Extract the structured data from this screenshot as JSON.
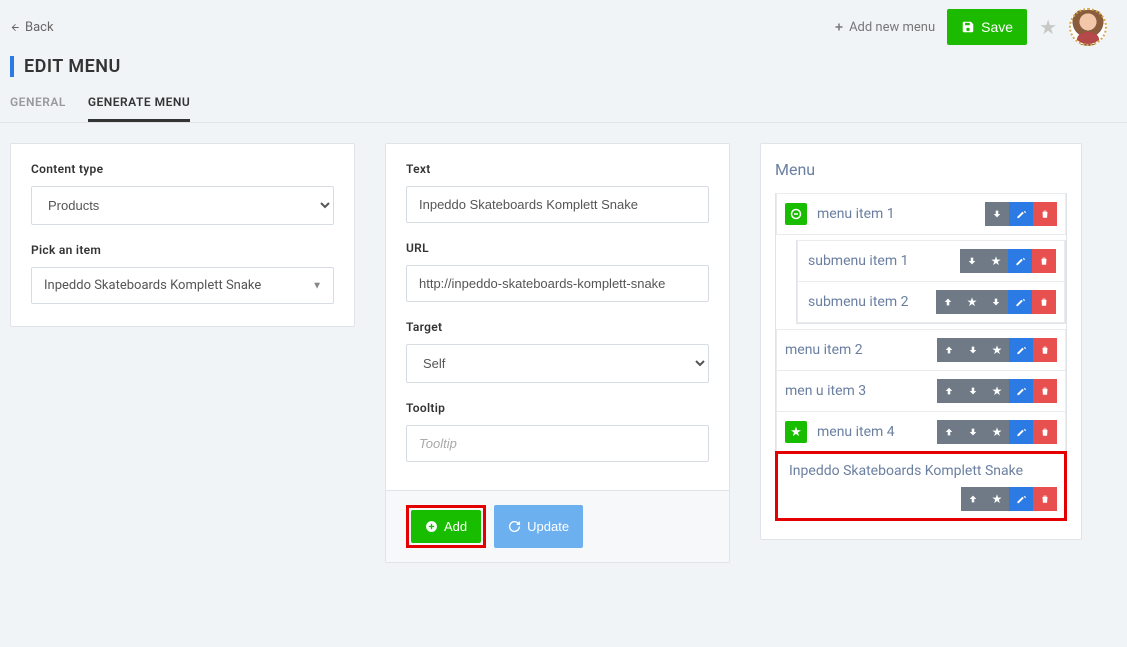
{
  "back_label": "Back",
  "header": {
    "add_menu_label": "Add new menu",
    "save_label": "Save"
  },
  "page_title": "EDIT MENU",
  "tabs": {
    "general": "GENERAL",
    "generate": "GENERATE MENU"
  },
  "left": {
    "content_type_label": "Content type",
    "content_type_value": "Products",
    "pick_item_label": "Pick an item",
    "pick_item_value": "Inpeddo Skateboards Komplett Snake"
  },
  "center": {
    "text_label": "Text",
    "text_value": "Inpeddo Skateboards Komplett Snake",
    "url_label": "URL",
    "url_value": "http://inpeddo-skateboards-komplett-snake",
    "target_label": "Target",
    "target_value": "Self",
    "tooltip_label": "Tooltip",
    "tooltip_placeholder": "Tooltip",
    "add_label": "Add",
    "update_label": "Update"
  },
  "right": {
    "title": "Menu",
    "items": [
      {
        "label": "menu item 1"
      },
      {
        "label": "submenu item 1"
      },
      {
        "label": "submenu item 2"
      },
      {
        "label": "menu item 2"
      },
      {
        "label": "men u item 3"
      },
      {
        "label": "menu item 4"
      },
      {
        "label": "Inpeddo Skateboards Komplett Snake"
      }
    ]
  }
}
